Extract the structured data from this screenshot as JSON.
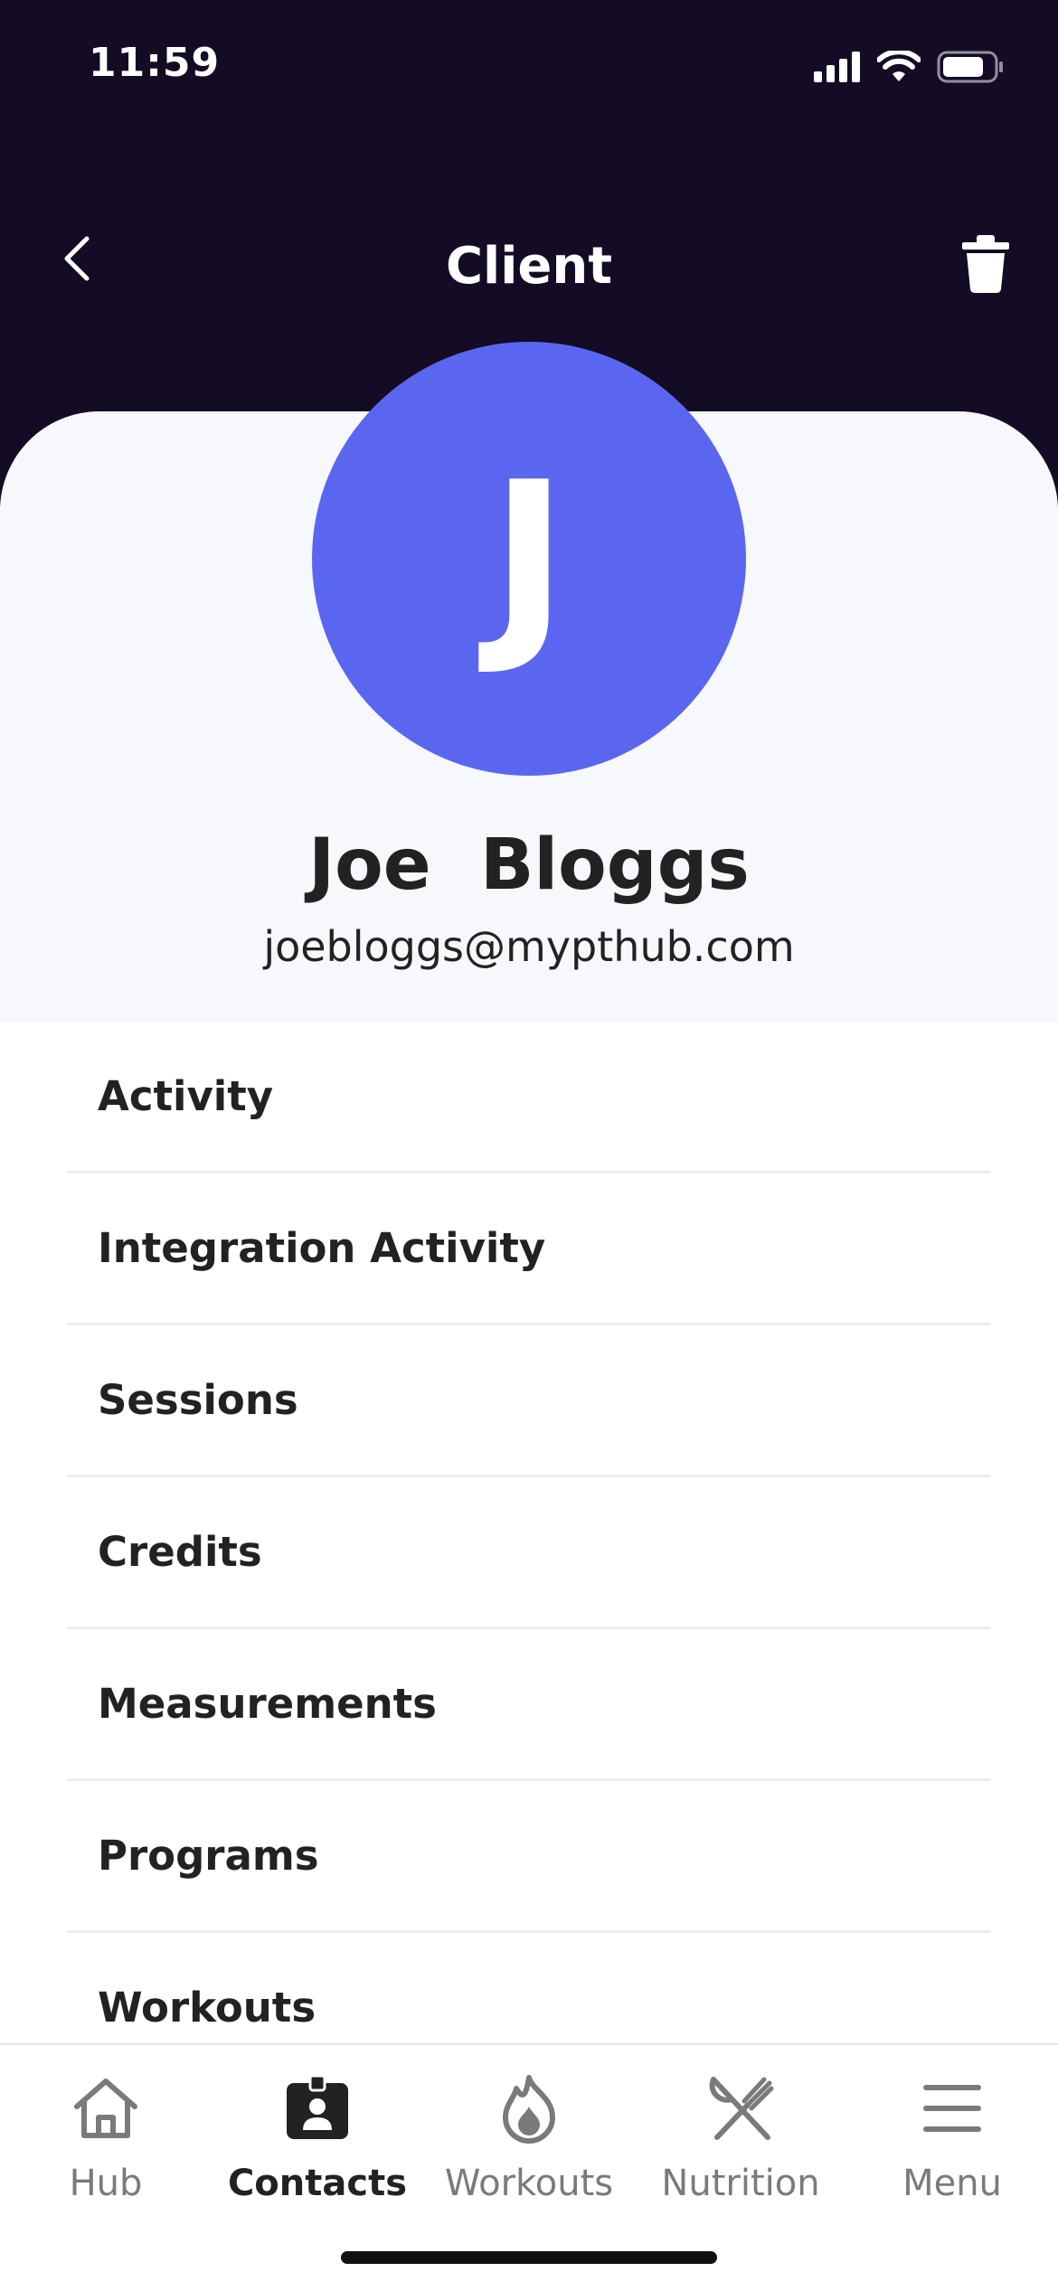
{
  "status_bar": {
    "time": "11:59"
  },
  "header": {
    "title": "Client"
  },
  "profile": {
    "initial": "J",
    "name": "Joe  Bloggs",
    "email": "joebloggs@mypthub.com"
  },
  "menu": {
    "items": [
      {
        "label": "Activity"
      },
      {
        "label": "Integration Activity"
      },
      {
        "label": "Sessions"
      },
      {
        "label": "Credits"
      },
      {
        "label": "Measurements"
      },
      {
        "label": "Programs"
      },
      {
        "label": "Workouts"
      }
    ]
  },
  "tab_bar": {
    "tabs": [
      {
        "label": "Hub",
        "icon": "home-icon"
      },
      {
        "label": "Contacts",
        "icon": "contacts-icon",
        "active": true
      },
      {
        "label": "Workouts",
        "icon": "flame-icon"
      },
      {
        "label": "Nutrition",
        "icon": "utensils-icon"
      },
      {
        "label": "Menu",
        "icon": "hamburger-icon"
      }
    ]
  },
  "colors": {
    "header_bg": "#140b25",
    "avatar_bg": "#5b66f0",
    "card_bg": "#f7f8fc"
  }
}
